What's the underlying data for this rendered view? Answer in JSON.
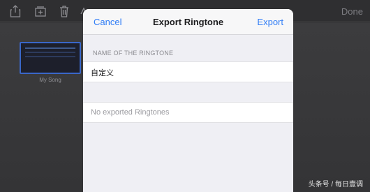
{
  "background_app": {
    "toolbar_icons": [
      "share-icon",
      "add-to-icon",
      "trash-icon",
      "collapsed-icon"
    ],
    "done_label": "Done",
    "song": {
      "name": "My Song"
    }
  },
  "modal": {
    "cancel_label": "Cancel",
    "title": "Export Ringtone",
    "export_label": "Export",
    "section_header": "NAME OF THE RINGTONE",
    "ringtone_name_value": "自定义",
    "empty_message": "No exported Ringtones"
  },
  "watermark": "头条号 / 每日壹调",
  "colors": {
    "accent": "#2f7cf6",
    "modal_bg": "#efeff4",
    "app_bg": "#3a3a3c"
  }
}
